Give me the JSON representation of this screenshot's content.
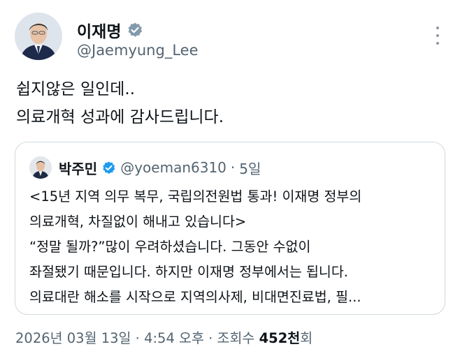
{
  "author": {
    "display_name": "이재명",
    "handle": "@Jaemyung_Lee"
  },
  "tweet": {
    "lines": [
      "쉽지않은 일인데..",
      "의료개혁 성과에 감사드립니다."
    ]
  },
  "quote": {
    "display_name": "박주민",
    "handle": "@yoeman6310",
    "separator": "·",
    "time": "5일",
    "lines": [
      "<15년 지역 의무 복무, 국립의전원법 통과! 이재명 정부의",
      "의료개혁, 차질없이 해내고 있습니다>",
      "“정말 될까?”많이 우려하셨습니다. 그동안 수없이",
      "좌절됐기 때문입니다. 하지만 이재명 정부에서는 됩니다.",
      "의료대란 해소를 시작으로 지역의사제, 비대면진료법, 필..."
    ]
  },
  "meta": {
    "timestamp": "2026년 03월 13일 · 4:54 오후 · ",
    "views_label": "조회수 ",
    "views_count": "452천",
    "views_suffix": "회"
  },
  "colors": {
    "verified_badge": "#829aab",
    "quote_verified_badge": "#1d9bf0",
    "secondary_text": "#536471",
    "border": "#cfd9de"
  },
  "icons": {
    "verified": "verified-badge-icon",
    "more": "more-options-icon"
  }
}
